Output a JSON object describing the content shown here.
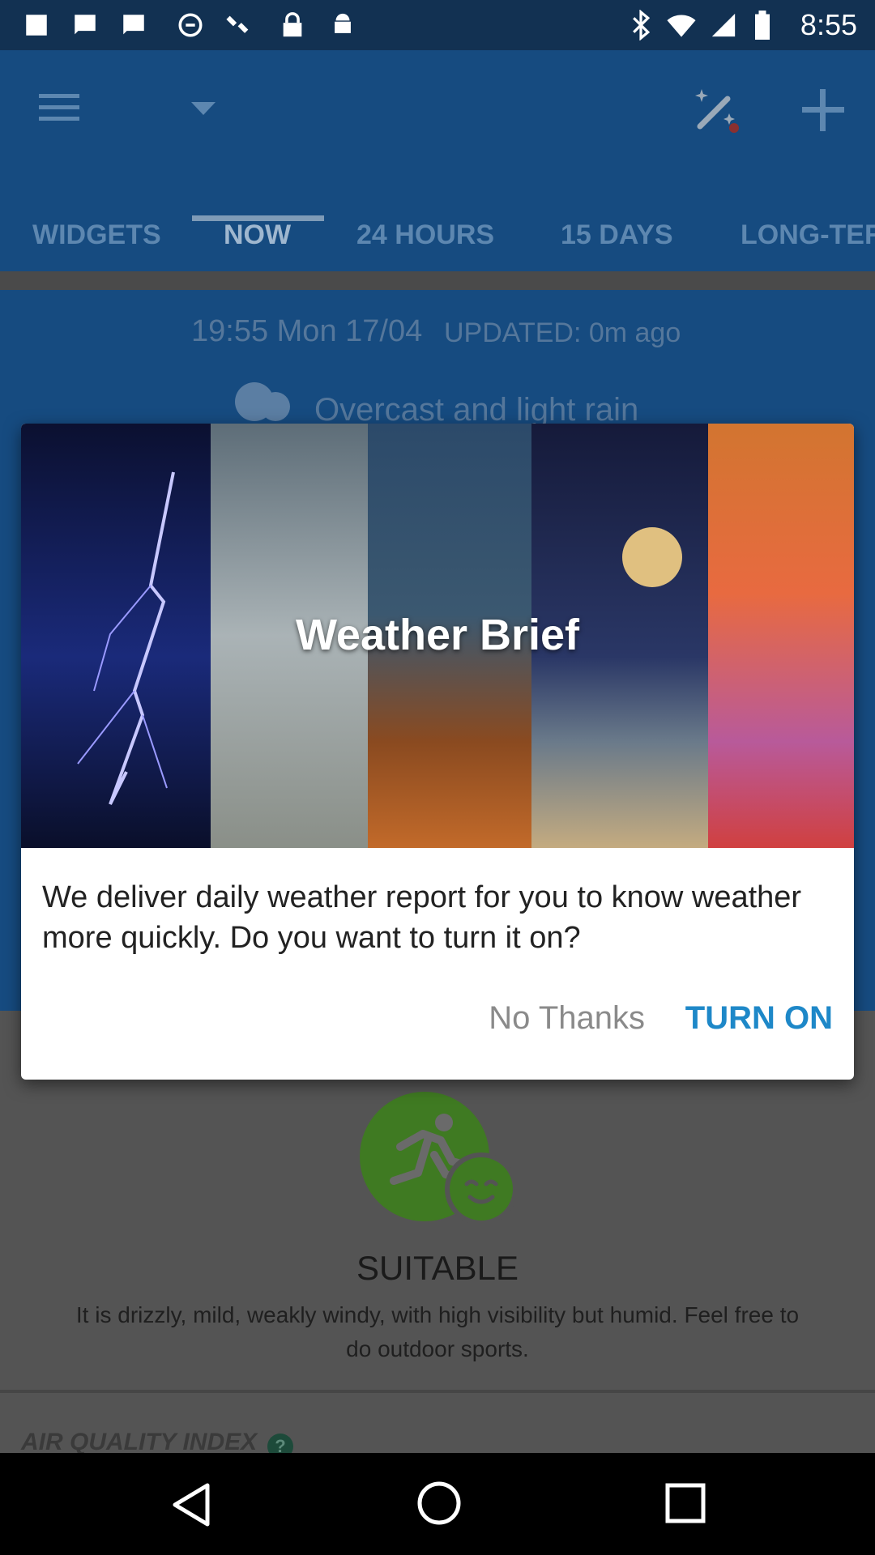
{
  "status_bar": {
    "time": "8:55",
    "icons": [
      "photo-icon",
      "message-icon",
      "blocked-icon",
      "satellite-icon",
      "lock-icon",
      "android-icon",
      "bluetooth-icon",
      "wifi-icon",
      "signal-icon",
      "battery-icon"
    ]
  },
  "toolbar": {
    "menu_icon": "menu-icon",
    "dropdown_icon": "dropdown-icon",
    "theme_icon": "magic-wand-icon",
    "add_icon": "plus-icon"
  },
  "tabs": [
    {
      "label": "WIDGETS"
    },
    {
      "label": "NOW"
    },
    {
      "label": "24 HOURS"
    },
    {
      "label": "15 DAYS"
    },
    {
      "label": "LONG-TER"
    }
  ],
  "now": {
    "timestamp": "19:55 Mon 17/04",
    "updated": "UPDATED: 0m ago",
    "condition": "Overcast and light rain"
  },
  "activity": {
    "status": "SUITABLE",
    "description_line1": "It is drizzly, mild, weakly windy, with high visibility but humid. Feel free to",
    "description_line2": "do outdoor sports.",
    "aqi_label": "AIR QUALITY INDEX",
    "help_badge": "?"
  },
  "dialog": {
    "title": "Weather Brief",
    "message": "We deliver daily weather report for you to know weather more quickly. Do you want to turn it on?",
    "cancel_label": "No Thanks",
    "confirm_label": "TURN ON"
  },
  "colors": {
    "primary": "#164b80",
    "accent": "#1e88c8",
    "activity_green": "#5da626"
  }
}
